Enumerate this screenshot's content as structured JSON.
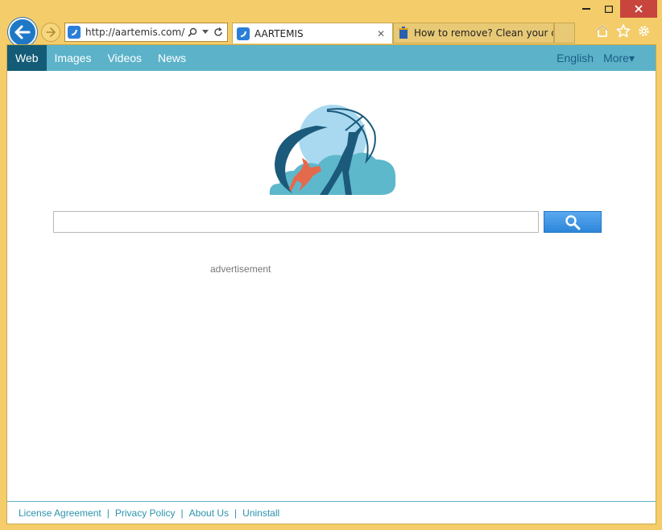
{
  "window": {
    "minimize_label": "▬",
    "maximize_label": "☐",
    "close_label": "✕"
  },
  "browser": {
    "address_url": "http://aartemis.com/",
    "tabs": [
      {
        "title": "AARTEMIS",
        "close_label": "✕"
      },
      {
        "title": "How to remove? Clean your co..."
      }
    ],
    "toolbar_icons": [
      "home-icon",
      "star-icon",
      "gear-icon"
    ]
  },
  "site_nav": {
    "items": [
      {
        "label": "Web",
        "active": true
      },
      {
        "label": "Images"
      },
      {
        "label": "Videos"
      },
      {
        "label": "News"
      }
    ],
    "language": "English",
    "more": "More▾"
  },
  "search": {
    "value": "",
    "placeholder": ""
  },
  "advertisement": "advertisement",
  "footer": {
    "links": [
      "License Agreement",
      "Privacy Policy",
      "About Us",
      "Uninstall"
    ],
    "separator": "|"
  },
  "colors": {
    "frame": "#f4cd6a",
    "nav_bar": "#5cb3c9",
    "nav_active": "#135b76",
    "search_button": "#3a90dd",
    "link": "#2b93ad"
  }
}
